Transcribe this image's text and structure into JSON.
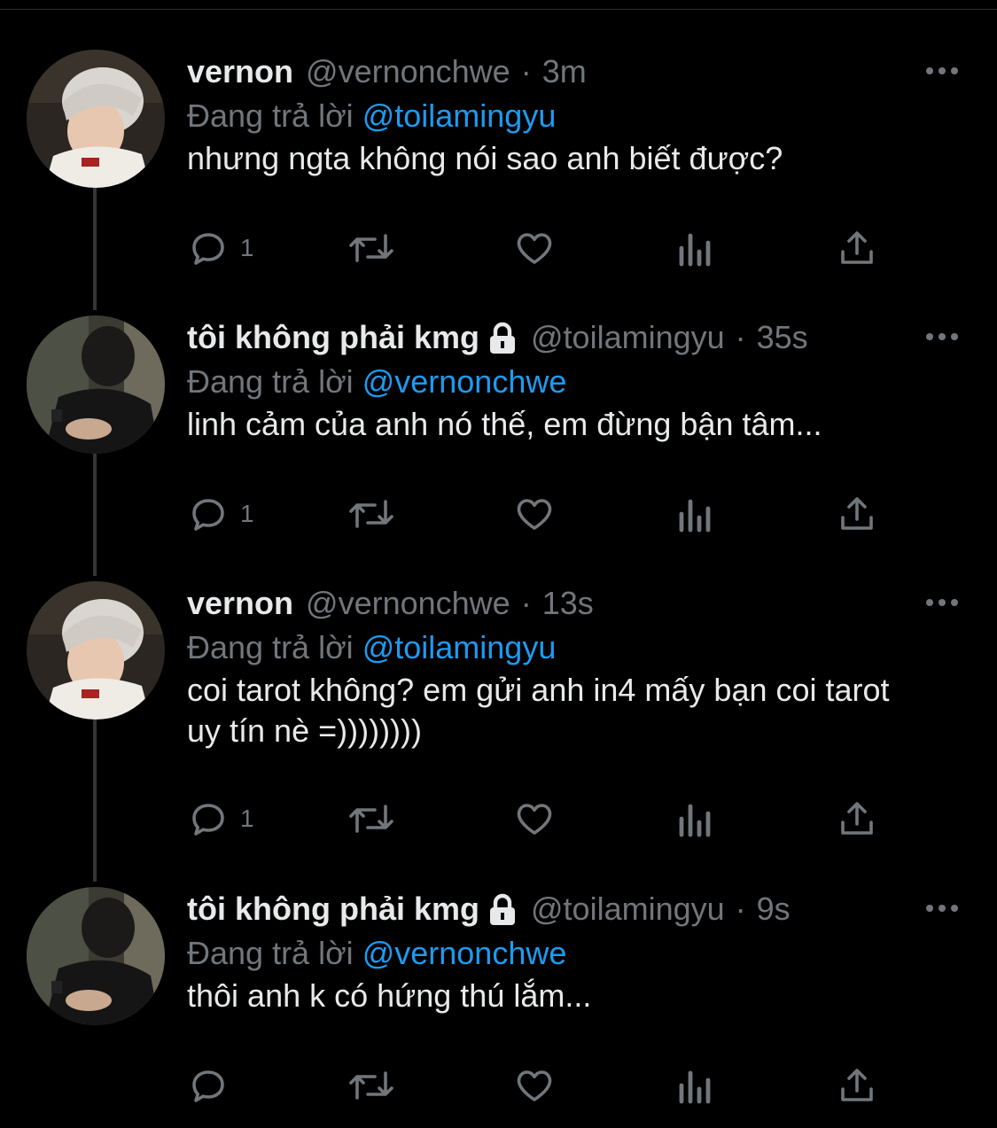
{
  "colors": {
    "background": "#000000",
    "text": "#e7e9ea",
    "muted": "#71767b",
    "mention": "#1d9bf0",
    "thread_line": "#333639"
  },
  "reply_prefix": "Đang trả lời",
  "tweets": [
    {
      "name": "vernon",
      "handle": "@vernonchwe",
      "separator": "·",
      "time": "3m",
      "locked": false,
      "reply_to": "@toilamingyu",
      "text": "nhưng ngta không nói sao anh biết được?",
      "reply_count": "1",
      "icons": [
        "reply-icon",
        "retweet-icon",
        "like-icon",
        "analytics-icon",
        "share-icon",
        "more-icon"
      ]
    },
    {
      "name": "tôi không phải kmg",
      "handle": "@toilamingyu",
      "separator": "·",
      "time": "35s",
      "locked": true,
      "reply_to": "@vernonchwe",
      "text": "linh cảm của anh nó thế, em đừng bận tâm...",
      "reply_count": "1",
      "icons": [
        "lock-icon",
        "reply-icon",
        "retweet-icon",
        "like-icon",
        "analytics-icon",
        "share-icon",
        "more-icon"
      ]
    },
    {
      "name": "vernon",
      "handle": "@vernonchwe",
      "separator": "·",
      "time": "13s",
      "locked": false,
      "reply_to": "@toilamingyu",
      "text": "coi tarot không? em gửi anh in4 mấy bạn coi tarot uy tín nè =))))))))",
      "reply_count": "1",
      "icons": [
        "reply-icon",
        "retweet-icon",
        "like-icon",
        "analytics-icon",
        "share-icon",
        "more-icon"
      ]
    },
    {
      "name": "tôi không phải kmg",
      "handle": "@toilamingyu",
      "separator": "·",
      "time": "9s",
      "locked": true,
      "reply_to": "@vernonchwe",
      "text": "thôi anh k có hứng thú lắm...",
      "reply_count": "",
      "icons": [
        "lock-icon",
        "reply-icon",
        "retweet-icon",
        "like-icon",
        "analytics-icon",
        "share-icon",
        "more-icon"
      ]
    }
  ]
}
